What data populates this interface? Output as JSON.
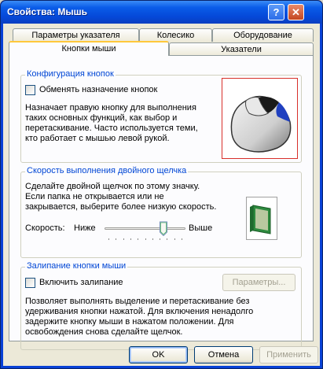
{
  "window": {
    "title": "Свойства: Мышь",
    "help_glyph": "?",
    "close_glyph": "✕"
  },
  "tabs": {
    "row1": [
      "Параметры указателя",
      "Колесико",
      "Оборудование"
    ],
    "row2": [
      "Кнопки мыши",
      "Указатели"
    ],
    "active": "Кнопки мыши"
  },
  "button_config": {
    "title": "Конфигурация кнопок",
    "swap_label": "Обменять назначение кнопок",
    "swap_checked": false,
    "description": [
      "Назначает правую кнопку для выполнения",
      "таких основных функций, как выбор и",
      "перетаскивание. Часто используется теми,",
      "кто работает с мышью левой рукой."
    ]
  },
  "double_click": {
    "title": "Скорость выполнения двойного щелчка",
    "description": [
      "Сделайте двойной щелчок по этому значку.",
      "Если папка не открывается или не",
      "закрывается, выберите более низкую скорость."
    ],
    "speed_label": "Скорость:",
    "slow_label": "Ниже",
    "fast_label": "Выше",
    "speed_level": 0.75
  },
  "click_lock": {
    "title": "Залипание кнопки мыши",
    "enable_label": "Включить залипание",
    "enable_checked": false,
    "settings_button": "Параметры...",
    "description": [
      "Позволяет выполнять выделение и перетаскивание без",
      "удерживания кнопки нажатой. Для включения ненадолго",
      "задержите кнопку мыши в нажатом положении. Для",
      "освобождения снова сделайте щелчок."
    ]
  },
  "buttons": {
    "ok": "OK",
    "cancel": "Отмена",
    "apply": "Применить"
  }
}
